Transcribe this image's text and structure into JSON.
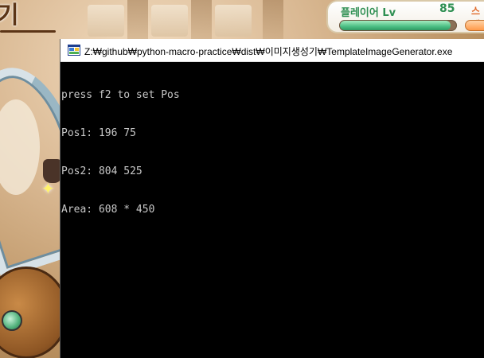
{
  "game": {
    "title_text": "기",
    "hud": {
      "player_level_label": "플레이어 Lv",
      "player_level_value": "85",
      "extra_label": "스태",
      "level_bar_fill": 0.95
    }
  },
  "console": {
    "window_title": "Z:₩github₩python-macro-practice₩dist₩이미지생성기₩TemplateImageGenerator.exe",
    "lines": [
      "press f2 to set Pos",
      "Pos1: 196 75",
      "Pos2: 804 525",
      "Area: 608 * 450"
    ]
  },
  "icons": {
    "app_icon": "console-app-icon",
    "sparkle": "sparkle-icon"
  },
  "colors": {
    "console_bg": "#000000",
    "console_text": "#c8c8c8",
    "hud_green": "#2e8f52",
    "title_brown": "#5b3416"
  }
}
